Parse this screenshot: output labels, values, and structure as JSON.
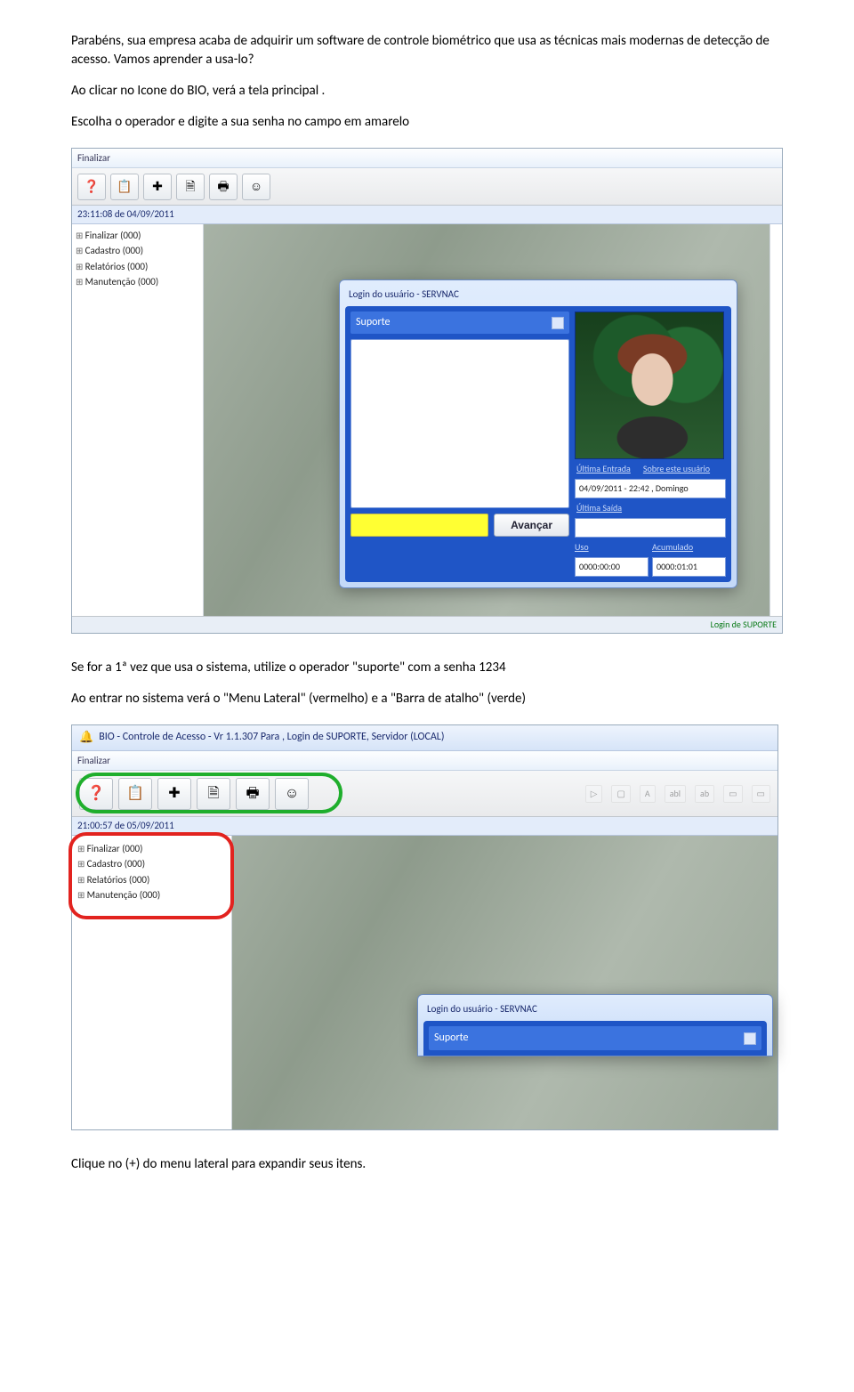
{
  "intro": {
    "p1": "Parabéns, sua empresa  acaba de adquirir um software de controle biométrico que usa as técnicas mais modernas de detecção de acesso. Vamos aprender a usa-lo?",
    "p2": "Ao clicar no Icone do BIO,  verá a tela principal .",
    "p3": "Escolha o operador e digite a sua senha no campo em amarelo"
  },
  "shot1": {
    "menu_finalizar": "Finalizar",
    "clock": "23:11:08 de 04/09/2011",
    "tree": {
      "finalizar": "Finalizar (000)",
      "cadastro": "Cadastro (000)",
      "relatorios": "Relatórios (000)",
      "manutencao": "Manutenção (000)"
    },
    "login": {
      "title": "Login do usuário - SERVNAC",
      "selected_user": "Suporte",
      "advance_btn": "Avançar",
      "link_ultima_entrada": "Última Entrada",
      "link_sobre": "Sobre este usuário",
      "ultima_entrada_val": "04/09/2011 - 22:42 , Domingo",
      "link_ultima_saida": "Última Saída",
      "label_uso": "Uso",
      "label_acumulado": "Acumulado",
      "uso_val": "0000:00:00",
      "acumulado_val": "0000:01:01"
    },
    "status": "Login de  SUPORTE",
    "icons": {
      "help": "❓",
      "clipboard": "📋",
      "plus": "✚",
      "doc": "🗎",
      "print": "🖶",
      "smile": "☺"
    }
  },
  "mid": {
    "p1": "Se for a 1ª vez que usa o sistema, utilize o operador \"suporte\" com a senha 1234",
    "p2": "Ao entrar no sistema verá o \"Menu Lateral\" (vermelho) e a \"Barra de atalho\" (verde)"
  },
  "shot2": {
    "title_icon": "🔔",
    "title": "BIO - Controle de Acesso - Vr 1.1.307 Para , Login de SUPORTE, Servidor (LOCAL)",
    "menu_finalizar": "Finalizar",
    "clock": "21:00:57 de 05/09/2011",
    "tree": {
      "finalizar": "Finalizar (000)",
      "cadastro": "Cadastro (000)",
      "relatorios": "Relatórios (000)",
      "manutencao": "Manutenção (000)"
    },
    "ghost": {
      "a": "A",
      "abl": "abl",
      "ab": "ab"
    },
    "login": {
      "title": "Login do usuário - SERVNAC",
      "selected_user": "Suporte"
    },
    "icons": {
      "help": "❓",
      "clipboard": "📋",
      "plus": "✚",
      "doc": "🗎",
      "print": "🖶",
      "smile": "☺"
    }
  },
  "outro": {
    "p1": "Clique no (+) do menu lateral para expandir seus itens."
  }
}
